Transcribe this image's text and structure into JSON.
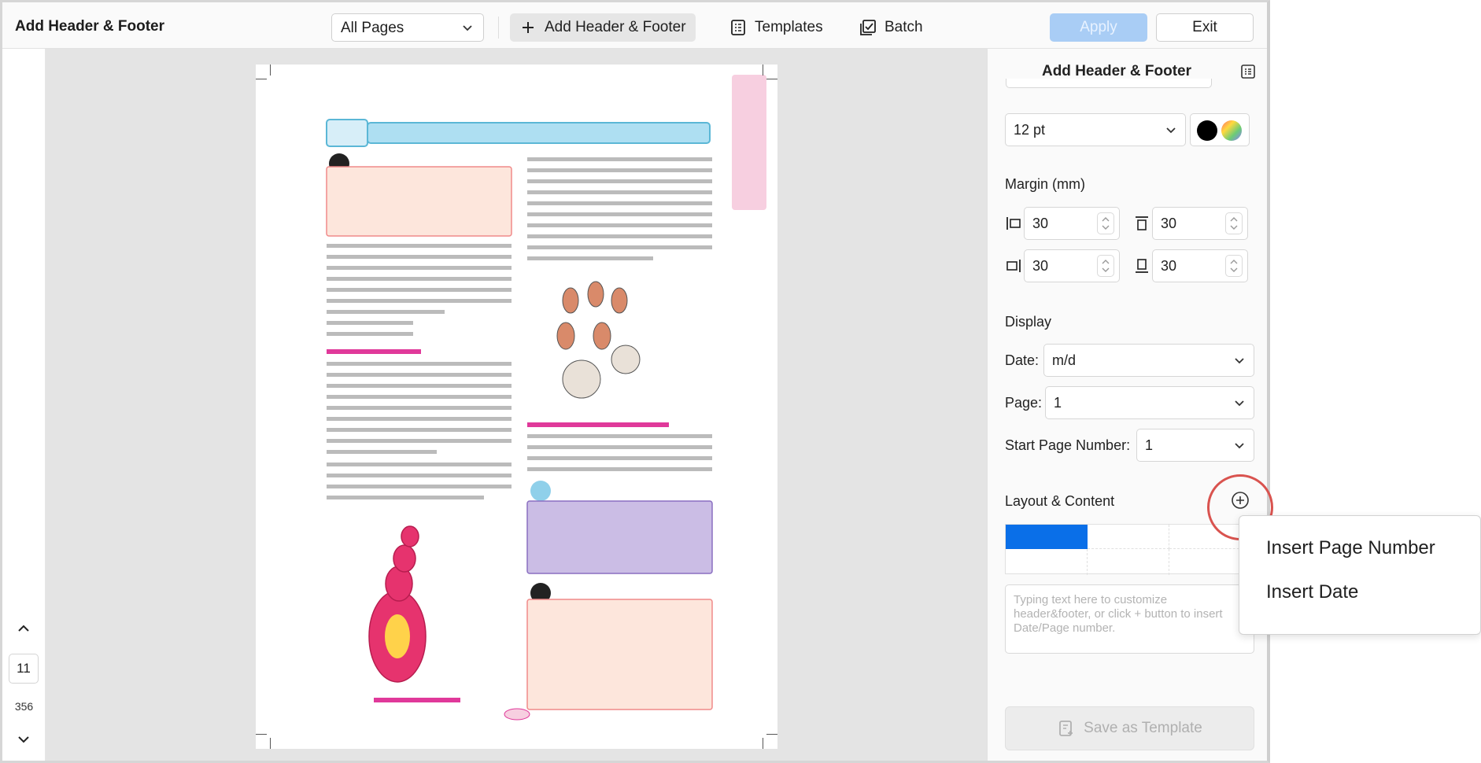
{
  "app": {
    "title": "Add Header & Footer"
  },
  "toolbar": {
    "page_range": "All Pages",
    "add_header_footer": "Add Header & Footer",
    "templates": "Templates",
    "batch": "Batch",
    "apply": "Apply",
    "exit": "Exit"
  },
  "leftnav": {
    "current_page": "11",
    "total_pages": "356"
  },
  "panel": {
    "title": "Add Header & Footer",
    "font_size": "12 pt",
    "font_color": "#000000",
    "margin_label": "Margin (mm)",
    "margins": {
      "left": "30",
      "top": "30",
      "right": "30",
      "bottom": "30"
    },
    "display_label": "Display",
    "date_label": "Date:",
    "date_value": "m/d",
    "page_label": "Page:",
    "page_value": "1",
    "start_page_label": "Start Page Number:",
    "start_page_value": "1",
    "layout_label": "Layout & Content",
    "text_placeholder": "Typing text here to customize header&footer, or click + button to insert Date/Page number.",
    "save_template": "Save as Template"
  },
  "popup": {
    "insert_page_number": "Insert Page Number",
    "insert_date": "Insert Date"
  },
  "colors": {
    "accent": "#0a6fe8",
    "apply_disabled": "#a9cdf5",
    "highlight_ring": "#d9534f"
  }
}
